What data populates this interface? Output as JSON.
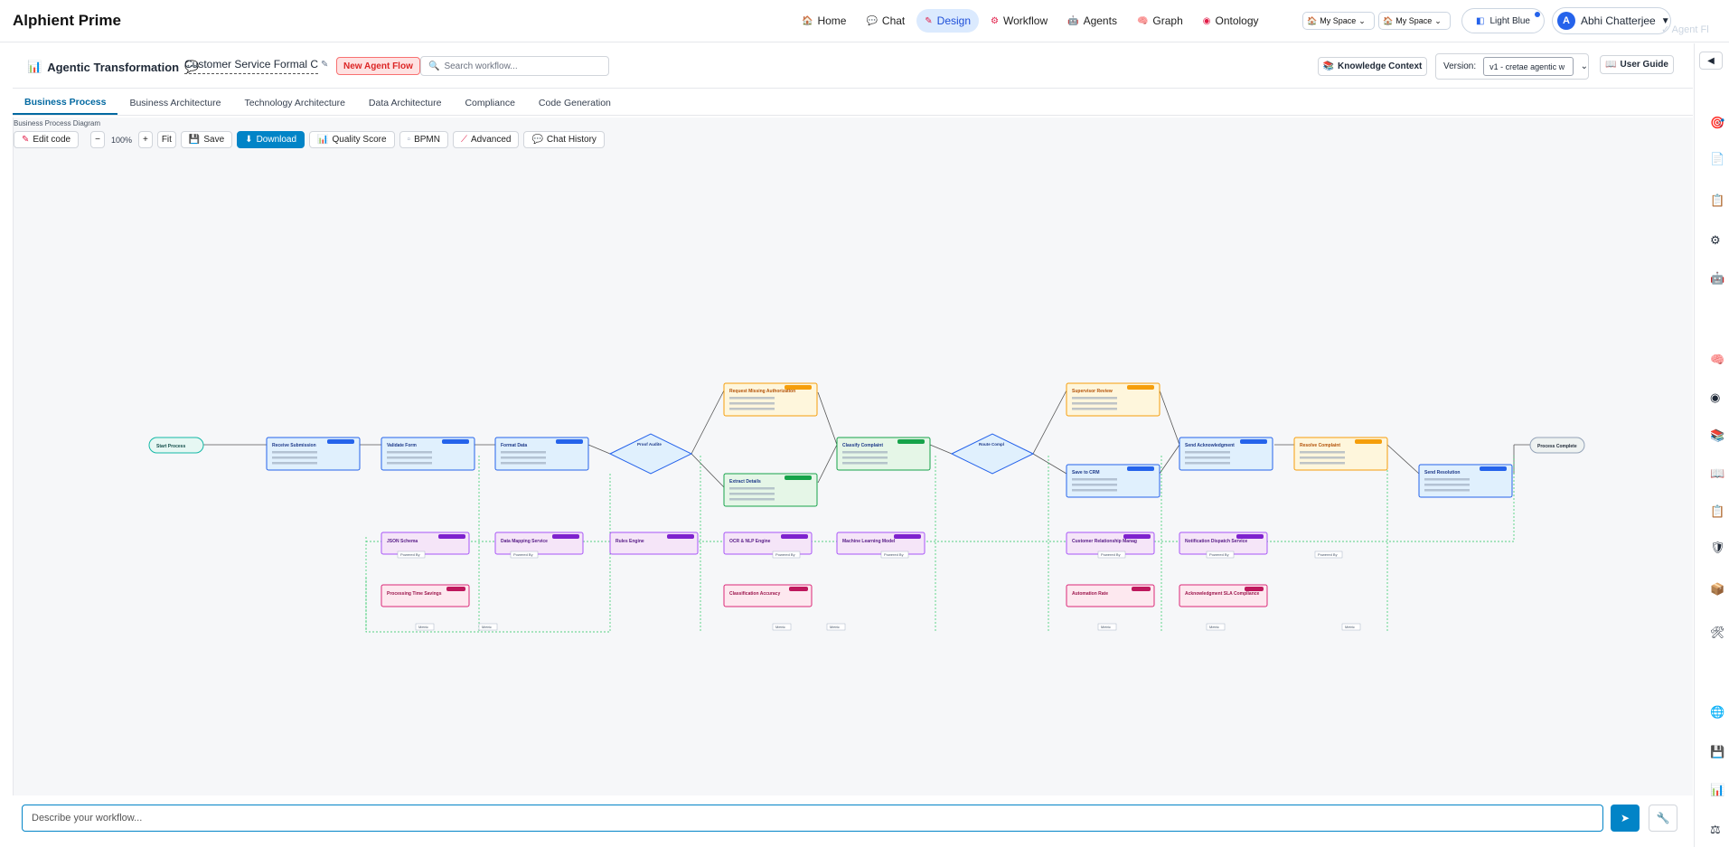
{
  "app": {
    "brand": "Alphient Prime"
  },
  "nav": [
    {
      "label": "Home",
      "icon": "home-icon",
      "glyph": "🏠"
    },
    {
      "label": "Chat",
      "icon": "chat-icon",
      "glyph": "💬"
    },
    {
      "label": "Design",
      "icon": "design-icon",
      "glyph": "✎",
      "active": true
    },
    {
      "label": "Workflow",
      "icon": "workflow-icon",
      "glyph": "⚙"
    },
    {
      "label": "Agents",
      "icon": "agents-icon",
      "glyph": "🤖"
    },
    {
      "label": "Graph",
      "icon": "graph-icon",
      "glyph": "🧠"
    },
    {
      "label": "Ontology",
      "icon": "ontology-icon",
      "glyph": "◉"
    }
  ],
  "spaces": [
    "My Space",
    "My Space"
  ],
  "theme": {
    "label": "Light Blue"
  },
  "user": {
    "initial": "A",
    "name": "Abhi Chatterjee"
  },
  "ghost": "✓ Agent Fl",
  "workflow": {
    "title": "Agentic Transformation",
    "name": "Customer Service Formal Co",
    "new_flow": "New Agent Flow",
    "search_placeholder": "Search workflow...",
    "knowledge": "Knowledge Context",
    "version_label": "Version:",
    "version_value": "v1 - cretae agentic w",
    "guide": "User Guide"
  },
  "tabs": [
    "Business Process",
    "Business Architecture",
    "Technology Architecture",
    "Data Architecture",
    "Compliance",
    "Code Generation"
  ],
  "canvas": {
    "label": "Business Process Diagram",
    "zoom": "100%",
    "buttons": {
      "edit": "Edit code",
      "fit": "Fit",
      "save": "Save",
      "download": "Download",
      "quality": "Quality Score",
      "bpmn": "BPMN",
      "advanced": "Advanced",
      "history": "Chat History"
    }
  },
  "diagram": {
    "colors": {
      "blue": "#2563eb",
      "orange": "#f59e0b",
      "green": "#16a34a",
      "purple": "#a855f7",
      "pink": "#db2777",
      "teal": "#14b8a6"
    },
    "start": "Start Process",
    "end": "Process Complete",
    "tasks": [
      {
        "id": "t1",
        "title": "Receive Submission",
        "color": "blue"
      },
      {
        "id": "t2",
        "title": "Validate Form",
        "color": "blue"
      },
      {
        "id": "t3",
        "title": "Format Data",
        "color": "blue"
      },
      {
        "id": "t4",
        "title": "Request Missing Authorization",
        "color": "orange"
      },
      {
        "id": "t5",
        "title": "Extract Details",
        "color": "green"
      },
      {
        "id": "t6",
        "title": "Classify Complaint",
        "color": "green"
      },
      {
        "id": "t7",
        "title": "Supervisor Review",
        "color": "orange"
      },
      {
        "id": "t8",
        "title": "Save to CRM",
        "color": "blue"
      },
      {
        "id": "t9",
        "title": "Send Acknowledgment",
        "color": "blue"
      },
      {
        "id": "t10",
        "title": "Resolve Complaint",
        "color": "orange"
      },
      {
        "id": "t11",
        "title": "Send Resolution",
        "color": "blue"
      }
    ],
    "gateways": [
      {
        "id": "g1",
        "title": "Proof Audite"
      },
      {
        "id": "g2",
        "title": "Route Compl"
      }
    ],
    "systems": [
      {
        "id": "s1",
        "title": "JSON Schema"
      },
      {
        "id": "s2",
        "title": "Data Mapping Service"
      },
      {
        "id": "s3",
        "title": "Rules Engine"
      },
      {
        "id": "s4",
        "title": "OCR & NLP Engine"
      },
      {
        "id": "s5",
        "title": "Machine Learning Model"
      },
      {
        "id": "s6",
        "title": "Customer Relationship Manag"
      },
      {
        "id": "s7",
        "title": "Notification Dispatch Service"
      }
    ],
    "metrics": [
      {
        "id": "m1",
        "title": "Processing Time Savings"
      },
      {
        "id": "m2",
        "title": "Classification Accuracy"
      },
      {
        "id": "m3",
        "title": "Automation Rate"
      },
      {
        "id": "m4",
        "title": "Acknowledgment SLA Compliance"
      }
    ],
    "edge_labels": {
      "powered": "Powered By",
      "metric": "Metric"
    }
  },
  "chat": {
    "placeholder": "Describe your workflow..."
  }
}
